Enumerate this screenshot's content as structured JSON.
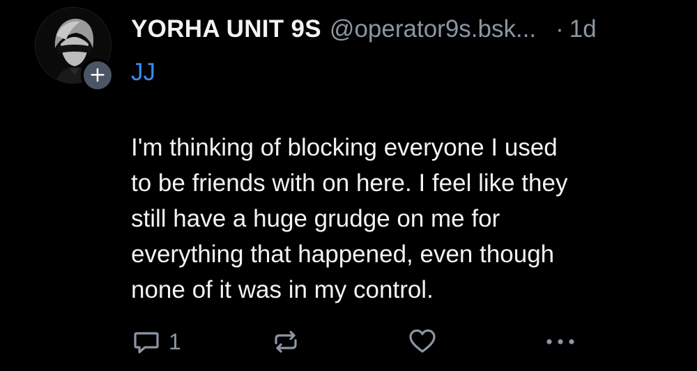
{
  "post": {
    "author": {
      "display_name": "YORHA UNIT 9S",
      "handle": "@operator9s.bsk...",
      "avatar_icon": "avatar-image",
      "follow_symbol": "+"
    },
    "separator": "·",
    "timestamp": "1d",
    "reply_to": "JJ",
    "body_lines": [
      "I'm thinking of blocking everyone I used",
      "to be friends with on here. I feel like they",
      "still have a huge grudge on me for",
      "everything that happened, even though",
      "none of it was in my control."
    ],
    "actions": {
      "reply_icon": "reply-icon",
      "reply_count": "1",
      "repost_icon": "repost-icon",
      "like_icon": "heart-icon",
      "more_icon": "more-icon"
    }
  },
  "colors": {
    "background": "#000000",
    "text_primary": "#f1f3f5",
    "text_secondary": "#8c96a4",
    "link": "#3b8af0",
    "badge": "#4b5566"
  }
}
